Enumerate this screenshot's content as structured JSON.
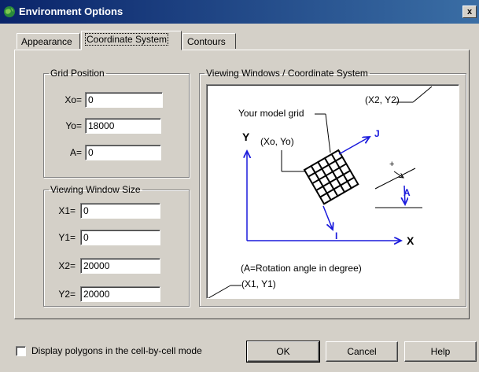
{
  "window": {
    "title": "Environment Options",
    "close_label": "x"
  },
  "tabs": [
    {
      "label": "Appearance",
      "active": false
    },
    {
      "label": "Coordinate System",
      "active": true
    },
    {
      "label": "Contours",
      "active": false
    }
  ],
  "grid_position": {
    "legend": "Grid Position",
    "fields": [
      {
        "label": "Xo=",
        "value": "0"
      },
      {
        "label": "Yo=",
        "value": "18000"
      },
      {
        "label": "A=",
        "value": "0"
      }
    ]
  },
  "viewing_window_size": {
    "legend": "Viewing Window Size",
    "fields": [
      {
        "label": "X1=",
        "value": "0"
      },
      {
        "label": "Y1=",
        "value": "0"
      },
      {
        "label": "X2=",
        "value": "20000"
      },
      {
        "label": "Y2=",
        "value": "20000"
      }
    ]
  },
  "diagram": {
    "legend": "Viewing Windows / Coordinate System",
    "x2y2": "(X2, Y2)",
    "model_grid": "Your model grid",
    "xoyo": "(Xo, Yo)",
    "axis_y": "Y",
    "axis_x": "X",
    "axis_j": "J",
    "axis_i": "I",
    "angle_label": "A",
    "rotation_note": "(A=Rotation angle in degree)",
    "x1y1": "(X1, Y1)",
    "axis_color": "#1a1adc"
  },
  "options": {
    "cell_mode_label": "Display polygons in the cell-by-cell mode",
    "cell_mode_checked": false
  },
  "buttons": {
    "ok": "OK",
    "cancel": "Cancel",
    "help": "Help"
  }
}
